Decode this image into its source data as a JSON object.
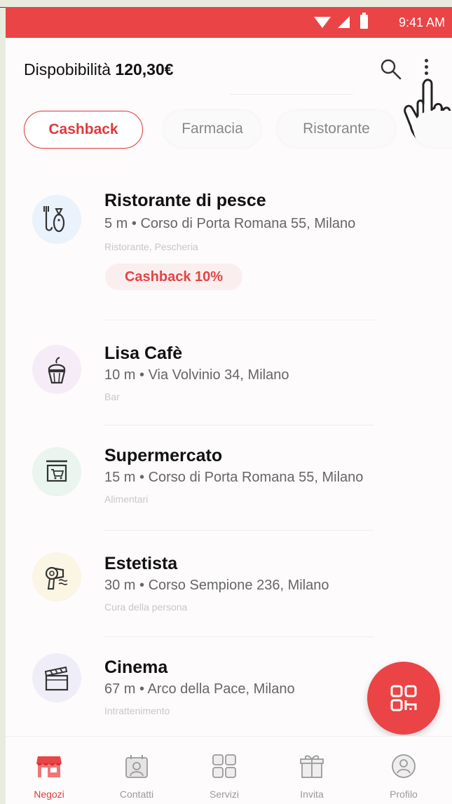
{
  "status_bar": {
    "time": "9:41 AM"
  },
  "header": {
    "balance_label": "Dispobibilità",
    "balance_value": "120,30€"
  },
  "chips": [
    {
      "label": "Cashback",
      "active": true
    },
    {
      "label": "Farmacia",
      "active": false
    },
    {
      "label": "Ristorante",
      "active": false
    },
    {
      "label": "",
      "active": false
    }
  ],
  "stores": [
    {
      "name": "Ristorante di pesce",
      "address": "5 m • Corso di Porta Romana 55, Milano",
      "category": "Ristorante, Pescheria",
      "badge": "Cashback 10%",
      "icon": "fish-restaurant-icon",
      "tint": "#eaf2fb"
    },
    {
      "name": "Lisa Cafè",
      "address": "10 m • Via Volvinio 34, Milano",
      "category": "Bar",
      "icon": "cupcake-icon",
      "tint": "#f5ecf8"
    },
    {
      "name": "Supermercato",
      "address": "15 m • Corso di Porta Romana 55, Milano",
      "category": "Alimentari",
      "icon": "shop-cart-sign-icon",
      "tint": "#e9f5ee"
    },
    {
      "name": "Estetista",
      "address": "30 m • Corso Sempione 236, Milano",
      "category": "Cura della persona",
      "icon": "hair-dryer-icon",
      "tint": "#fbf5e4"
    },
    {
      "name": "Cinema",
      "address": "67 m • Arco della Pace, Milano",
      "category": "Intrattenimento",
      "icon": "clapperboard-icon",
      "tint": "#efedf8"
    }
  ],
  "fab": {
    "icon": "qr-code-icon"
  },
  "bottom_nav": [
    {
      "label": "Negozi",
      "icon": "store-icon",
      "active": true
    },
    {
      "label": "Contatti",
      "icon": "contacts-icon",
      "active": false
    },
    {
      "label": "Servizi",
      "icon": "services-grid-icon",
      "active": false
    },
    {
      "label": "Invita",
      "icon": "gift-icon",
      "active": false
    },
    {
      "label": "Profilo",
      "icon": "profile-icon",
      "active": false
    }
  ],
  "colors": {
    "accent": "#ea4446",
    "text": "#111111",
    "muted": "#666666"
  }
}
